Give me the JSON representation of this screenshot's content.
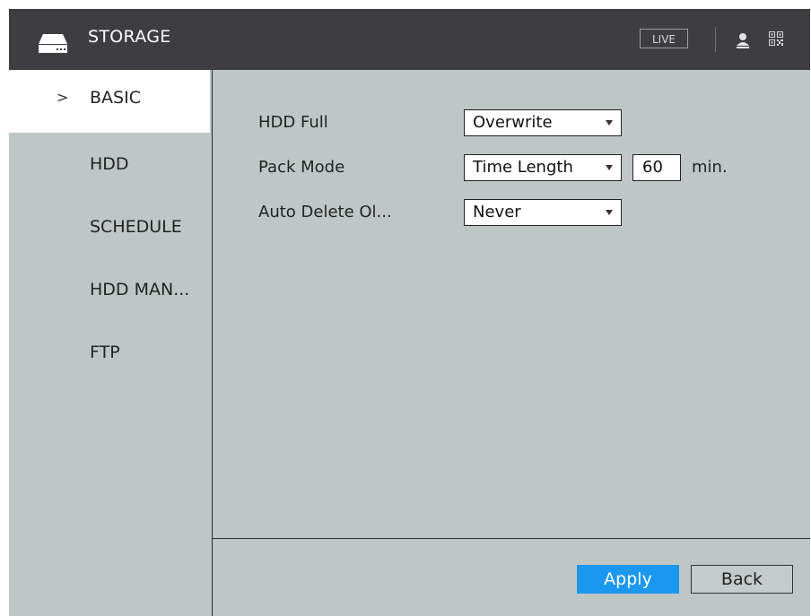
{
  "header": {
    "title": "STORAGE",
    "live_label": "LIVE",
    "icons": [
      "storage-icon",
      "user-icon",
      "qr-code-icon"
    ]
  },
  "sidebar": {
    "items": [
      {
        "label": "BASIC",
        "active": true,
        "marker": ">"
      },
      {
        "label": "HDD"
      },
      {
        "label": "SCHEDULE"
      },
      {
        "label": "HDD MAN..."
      },
      {
        "label": "FTP"
      }
    ]
  },
  "form": {
    "hdd_full": {
      "label": "HDD Full",
      "value": "Overwrite"
    },
    "pack_mode": {
      "label": "Pack Mode",
      "value": "Time Length",
      "duration": "60",
      "unit": "min."
    },
    "auto_delete": {
      "label": "Auto Delete Ol...",
      "value": "Never"
    }
  },
  "buttons": {
    "apply": "Apply",
    "back": "Back"
  },
  "colors": {
    "titlebar": "#3d3d42",
    "panel": "#bfc6c6",
    "accent": "#1a98f0"
  }
}
